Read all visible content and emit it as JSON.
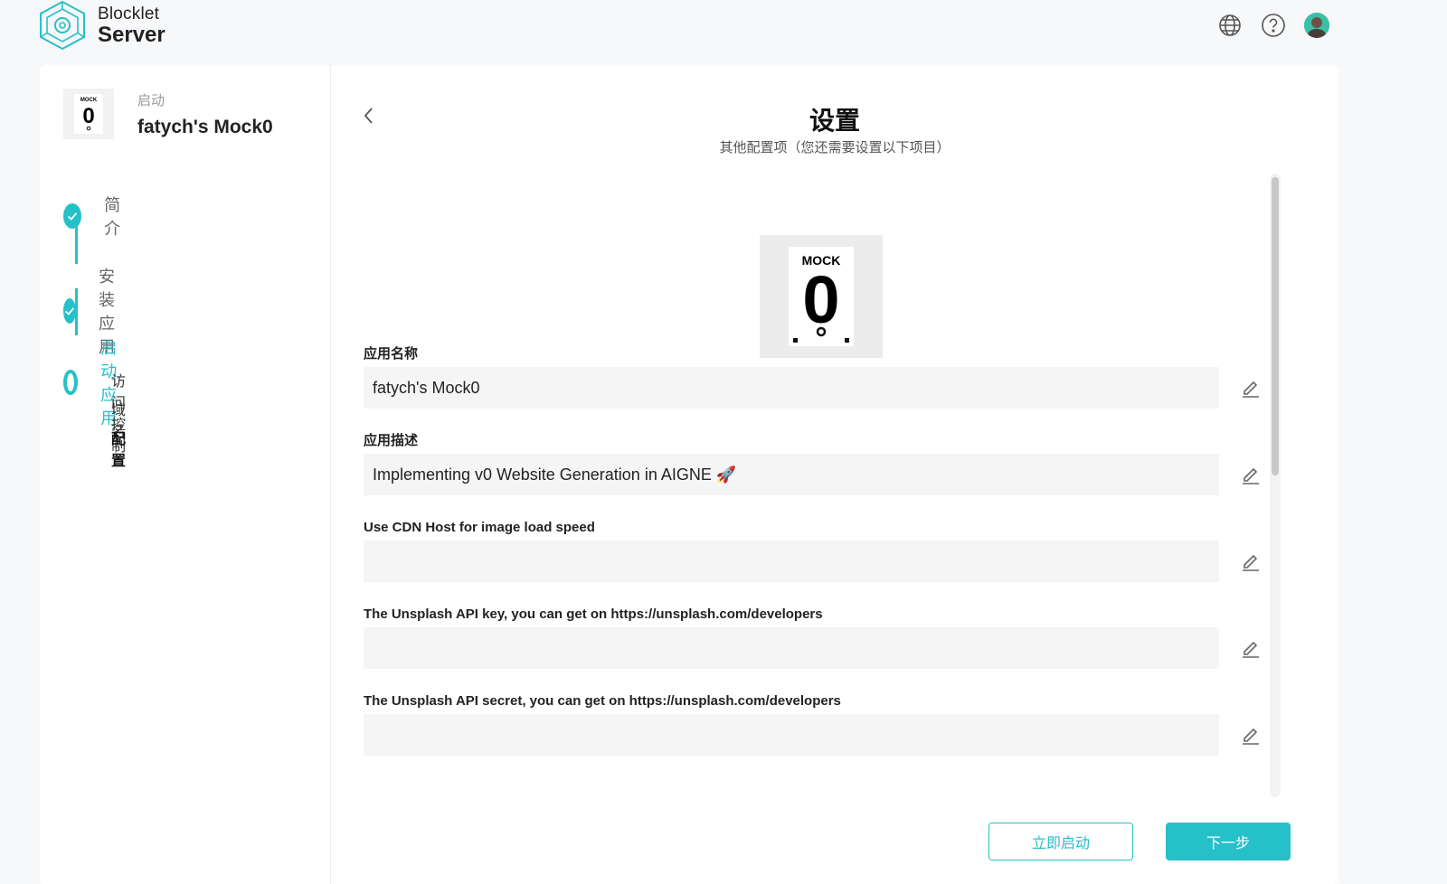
{
  "brand": {
    "line1": "Blocklet",
    "line2": "Server",
    "accent": "#26c0c9"
  },
  "header_icons": [
    "globe-icon",
    "help-icon",
    "avatar"
  ],
  "app": {
    "status": "启动",
    "name": "fatych's Mock0",
    "thumb_text": "0"
  },
  "steps": [
    {
      "label": "简介",
      "state": "done"
    },
    {
      "label": "安装应用",
      "state": "done"
    },
    {
      "label": "启动应用",
      "state": "current"
    }
  ],
  "substeps": [
    {
      "label": "访问控制"
    },
    {
      "label": "域名"
    },
    {
      "label": "配置"
    }
  ],
  "page": {
    "title": "设置",
    "subtitle": "其他配置项（您还需要设置以下项目）"
  },
  "logo_big": {
    "top_text": "MOCK",
    "digit": "0"
  },
  "fields": [
    {
      "label": "应用名称",
      "value": "fatych's Mock0"
    },
    {
      "label": "应用描述",
      "value": "Implementing v0 Website Generation in AIGNE 🚀"
    },
    {
      "label": "Use CDN Host for image load speed",
      "value": ""
    },
    {
      "label": "The Unsplash API key, you can get on https://unsplash.com/developers",
      "value": ""
    },
    {
      "label": "The Unsplash API secret, you can get on https://unsplash.com/developers",
      "value": ""
    }
  ],
  "actions": {
    "launch_now": "立即启动",
    "next": "下一步"
  }
}
